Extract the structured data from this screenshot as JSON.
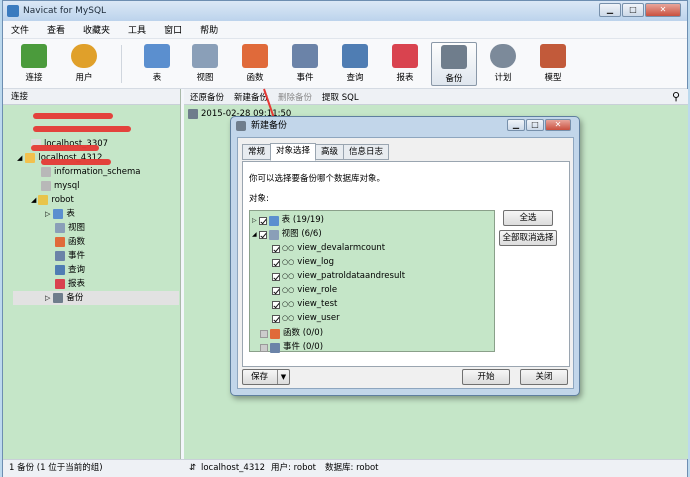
{
  "window": {
    "title": "Navicat for MySQL",
    "minimize": "▁",
    "maximize": "□",
    "close": "✕"
  },
  "menu": [
    "文件",
    "查看",
    "收藏夹",
    "工具",
    "窗口",
    "帮助"
  ],
  "toolbar": [
    {
      "label": "连接",
      "icon": "connection-icon",
      "color": "#4b9b3c"
    },
    {
      "label": "用户",
      "icon": "user-icon",
      "color": "#e0a02a"
    },
    {
      "label": "表",
      "icon": "table-icon",
      "color": "#5b8fcf"
    },
    {
      "label": "视图",
      "icon": "view-icon",
      "color": "#8a9fb8"
    },
    {
      "label": "函数",
      "icon": "function-icon",
      "color": "#e06a3a"
    },
    {
      "label": "事件",
      "icon": "event-icon",
      "color": "#6b83a8"
    },
    {
      "label": "查询",
      "icon": "query-icon",
      "color": "#4f7db3"
    },
    {
      "label": "报表",
      "icon": "report-icon",
      "color": "#d9434f"
    },
    {
      "label": "备份",
      "icon": "backup-icon",
      "color": "#6f7d8c"
    },
    {
      "label": "计划",
      "icon": "schedule-icon",
      "color": "#7c8a9a"
    },
    {
      "label": "模型",
      "icon": "model-icon",
      "color": "#c25a3a"
    }
  ],
  "left_pane": {
    "header": "连接",
    "connections": [
      {
        "label": "localhost_3307"
      },
      {
        "label": "localhost_4312"
      }
    ],
    "databases": [
      "information_schema",
      "mysql",
      "robot"
    ],
    "robot_children": [
      "表",
      "视图",
      "函数",
      "事件",
      "查询",
      "报表",
      "备份"
    ]
  },
  "subtoolbar": {
    "restore": "还原备份",
    "new": "新建备份",
    "delete": "删除备份",
    "extract": "提取 SQL"
  },
  "backup_file": "2015-02-28 09:11:50",
  "dialog": {
    "title": "新建备份",
    "tabs": [
      "常规",
      "对象选择",
      "高级",
      "信息日志"
    ],
    "prompt": "你可以选择要备份哪个数据库对象。",
    "objects_label": "对象:",
    "tree": {
      "tables": "表 (19/19)",
      "views": "视图 (6/6)",
      "view_items": [
        "view_devalarmcount",
        "view_log",
        "view_patroldataandresult",
        "view_role",
        "view_test",
        "view_user"
      ],
      "functions": "函数 (0/0)",
      "events": "事件 (0/0)"
    },
    "select_all": "全选",
    "deselect_all": "全部取消选择",
    "save": "保存",
    "start": "开始",
    "close": "关闭"
  },
  "status": {
    "left": "1 备份 (1 位于当前的组)",
    "conn": "localhost_4312",
    "user": "用户: robot",
    "db": "数据库: robot"
  }
}
